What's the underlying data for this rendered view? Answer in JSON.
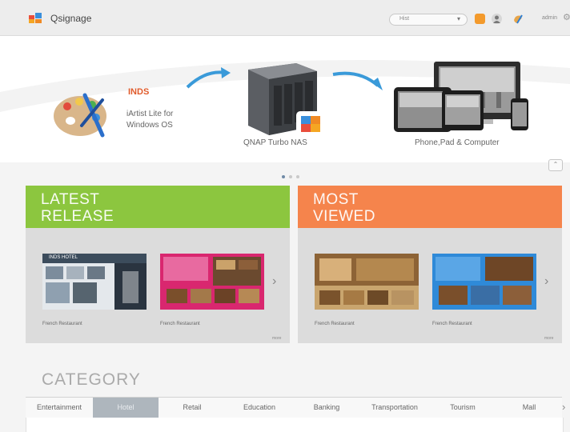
{
  "app": {
    "title": "Qsignage"
  },
  "header": {
    "search_value": "Hist",
    "user": "admin"
  },
  "banner": {
    "inds_logo": "INDS",
    "software_label": "iArtist Lite for",
    "software_label2": "Windows OS",
    "nas_label": "QNAP Turbo NAS",
    "devices_label": "Phone,Pad & Computer"
  },
  "carousel": {
    "pages": 3,
    "active": 1
  },
  "latest": {
    "title_line1": "LATEST",
    "title_line2": "RELEASE",
    "accent": "#8cc63f",
    "items": [
      {
        "caption": "French Restaurant",
        "thumb_text": "INDS HOTEL"
      },
      {
        "caption": "French Restaurant"
      }
    ],
    "more": "more"
  },
  "most_viewed": {
    "title_line1": "MOST",
    "title_line2": "VIEWED",
    "accent": "#f5844c",
    "items": [
      {
        "caption": "French Restaurant"
      },
      {
        "caption": "French Restaurant"
      }
    ],
    "more": "more"
  },
  "category": {
    "title": "CATEGORY",
    "tabs": [
      "Entertainment",
      "Hotel",
      "Retail",
      "Education",
      "Banking",
      "Transportation",
      "Tourism",
      "Mall"
    ],
    "active_index": 1
  },
  "colors": {
    "topbar": "#ededed",
    "arrow_blue": "#3a9ad9",
    "active_tab": "#aeb6bd"
  }
}
